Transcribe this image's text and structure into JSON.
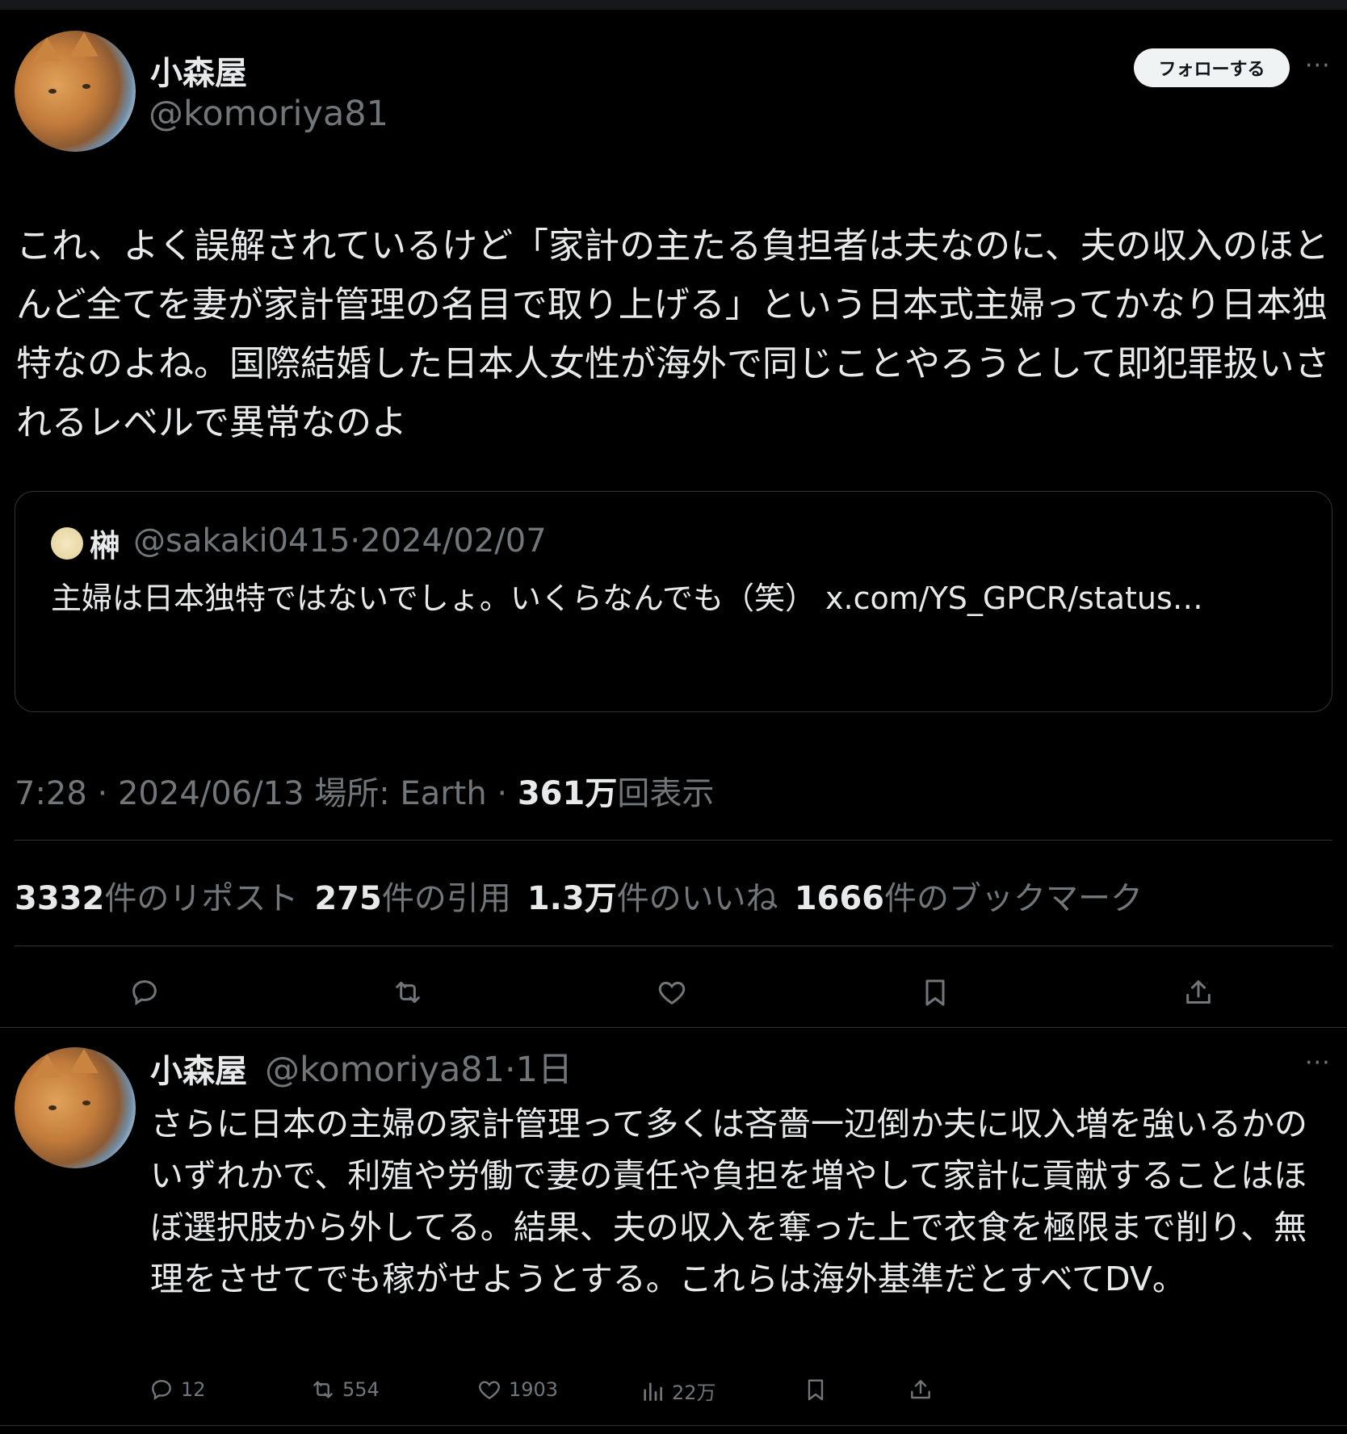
{
  "main_tweet": {
    "author_name": "小森屋",
    "author_handle": "@komoriya81",
    "follow_label": "フォローする",
    "more_label": "···",
    "text": "これ、よく誤解されているけど「家計の主たる負担者は夫なのに、夫の収入のほとんど全てを妻が家計管理の名目で取り上げる」という日本式主婦ってかなり日本独特なのよね。国際結婚した日本人女性が海外で同じことやろうとして即犯罪扱いされるレベルで異常なのよ",
    "quoted": {
      "name": "榊",
      "handle_date": "@sakaki0415·2024/02/07",
      "text": "主婦は日本独特ではないでしょ。いくらなんでも（笑） x.com/YS_GPCR/status…"
    },
    "meta": {
      "time_place": "7:28 · 2024/06/13 場所: Earth · ",
      "views_value": "361万",
      "views_label": "回表示"
    },
    "stats": {
      "reposts_value": "3332",
      "reposts_label": "件のリポスト",
      "quotes_value": "275",
      "quotes_label": "件の引用",
      "likes_value": "1.3万",
      "likes_label": "件のいいね",
      "bookmarks_value": "1666",
      "bookmarks_label": "件のブックマーク"
    },
    "actions": [
      "reply-icon",
      "repost-icon",
      "like-icon",
      "bookmark-icon",
      "share-icon"
    ]
  },
  "reply_tweet": {
    "author_name": "小森屋",
    "author_handle_time": "@komoriya81·1日",
    "more_label": "···",
    "text": "さらに日本の主婦の家計管理って多くは吝嗇一辺倒か夫に収入増を強いるかのいずれかで、利殖や労働で妻の責任や負担を増やして家計に貢献することはほぼ選択肢から外してる。結果、夫の収入を奪った上で衣食を極限まで削り、無理をさせてでも稼がせようとする。これらは海外基準だとすべてDV。",
    "actions": {
      "replies": "12",
      "reposts": "554",
      "likes": "1903",
      "views": "22万"
    }
  },
  "colors": {
    "background": "#000000",
    "text_primary": "#e7e9ea",
    "text_secondary": "#71767b",
    "border": "#2f3336",
    "follow_bg": "#eff3f4"
  }
}
